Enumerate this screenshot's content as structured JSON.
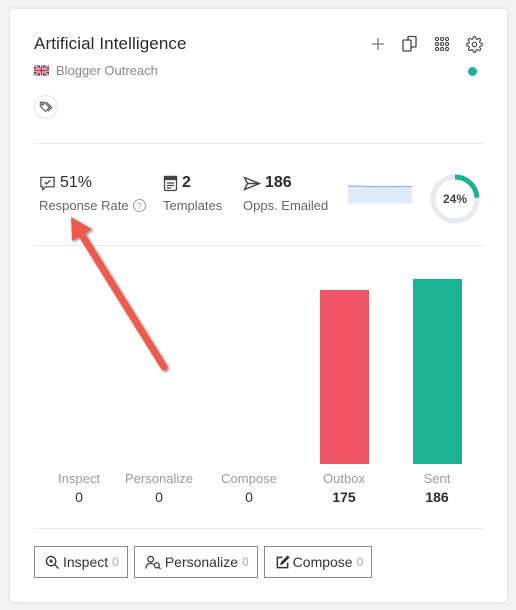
{
  "card": {
    "title": "Artificial Intelligence",
    "subtitle": "Blogger Outreach",
    "flag_icon": "uk-flag-icon",
    "tag_icon": "tags-icon",
    "status_color": "#1ab394",
    "top_icons": [
      "plus-icon",
      "copy-icon",
      "grid-icon",
      "gear-icon"
    ]
  },
  "stats": {
    "response_rate": {
      "value": "51%",
      "label": "Response Rate",
      "help": "?"
    },
    "templates": {
      "value": "2",
      "label": "Templates"
    },
    "opps_emailed": {
      "value": "186",
      "label": "Opps. Emailed"
    },
    "progress_percent": 24,
    "progress_label": "24%"
  },
  "pipeline": {
    "columns": [
      {
        "name": "Inspect",
        "count": "0",
        "value": 0
      },
      {
        "name": "Personalize",
        "count": "0",
        "value": 0
      },
      {
        "name": "Compose",
        "count": "0",
        "value": 0
      },
      {
        "name": "Outbox",
        "count": "175",
        "value": 175,
        "color": "#ef5565"
      },
      {
        "name": "Sent",
        "count": "186",
        "value": 186,
        "color": "#1ab394"
      }
    ]
  },
  "buttons": [
    {
      "label": "Inspect",
      "count": "0"
    },
    {
      "label": "Personalize",
      "count": "0"
    },
    {
      "label": "Compose",
      "count": "0"
    }
  ],
  "annotation": {
    "arrow_color": "#f05a4c"
  }
}
